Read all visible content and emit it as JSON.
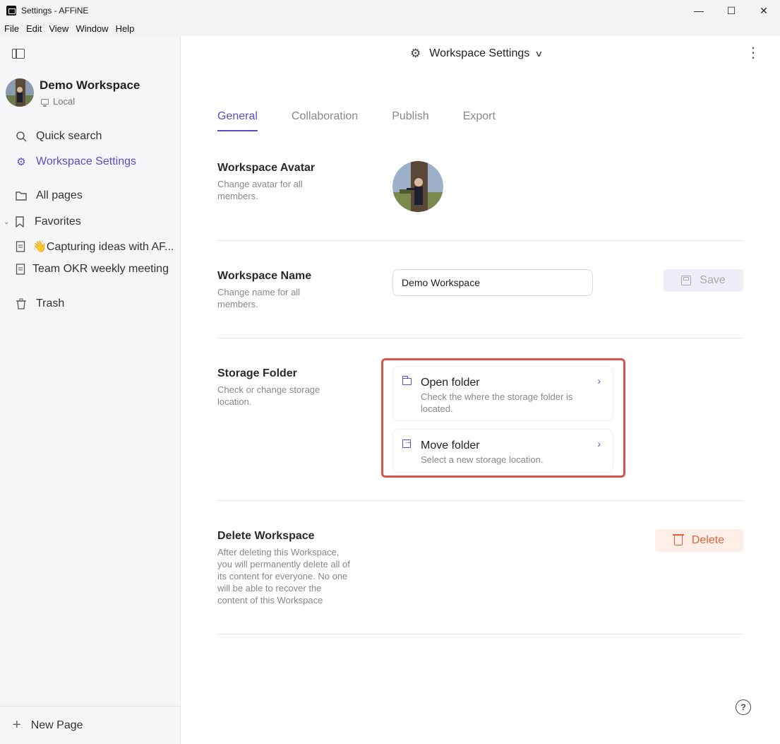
{
  "window": {
    "title": "Settings - AFFiNE",
    "controls": {
      "minimize": "—",
      "maximize": "☐",
      "close": "✕"
    }
  },
  "menubar": [
    "File",
    "Edit",
    "Window",
    "Help"
  ],
  "menubar_labels": {
    "file": "File",
    "edit": "Edit",
    "view": "View",
    "window": "Window",
    "help": "Help"
  },
  "sidebar": {
    "workspace_name": "Demo Workspace",
    "workspace_location": "Local",
    "items": {
      "quick_search": "Quick search",
      "workspace_settings": "Workspace Settings",
      "all_pages": "All pages",
      "favorites": "Favorites",
      "fav_page_1": "👋Capturing ideas with AF...",
      "fav_page_2": "Team OKR weekly meeting",
      "trash": "Trash"
    },
    "new_page": "New Page"
  },
  "header": {
    "title": "Workspace Settings"
  },
  "tabs": {
    "general": "General",
    "collaboration": "Collaboration",
    "publish": "Publish",
    "export": "Export",
    "active": "General"
  },
  "sections": {
    "avatar": {
      "title": "Workspace Avatar",
      "desc": "Change avatar for all members."
    },
    "name": {
      "title": "Workspace Name",
      "desc": "Change name for all members.",
      "input_value": "Demo Workspace",
      "save_label": "Save"
    },
    "storage": {
      "title": "Storage Folder",
      "desc": "Check or change storage location.",
      "open_title": "Open folder",
      "open_desc": "Check the where the storage folder is located.",
      "move_title": "Move folder",
      "move_desc": "Select a new storage location."
    },
    "delete": {
      "title": "Delete Workspace",
      "desc": "After deleting this Workspace, you will permanently delete all of its content for everyone. No one will be able to recover the content of this Workspace",
      "button_label": "Delete"
    }
  },
  "colors": {
    "accent": "#5b4dc7",
    "danger": "#e0643a",
    "highlight_border": "#d9534f"
  }
}
